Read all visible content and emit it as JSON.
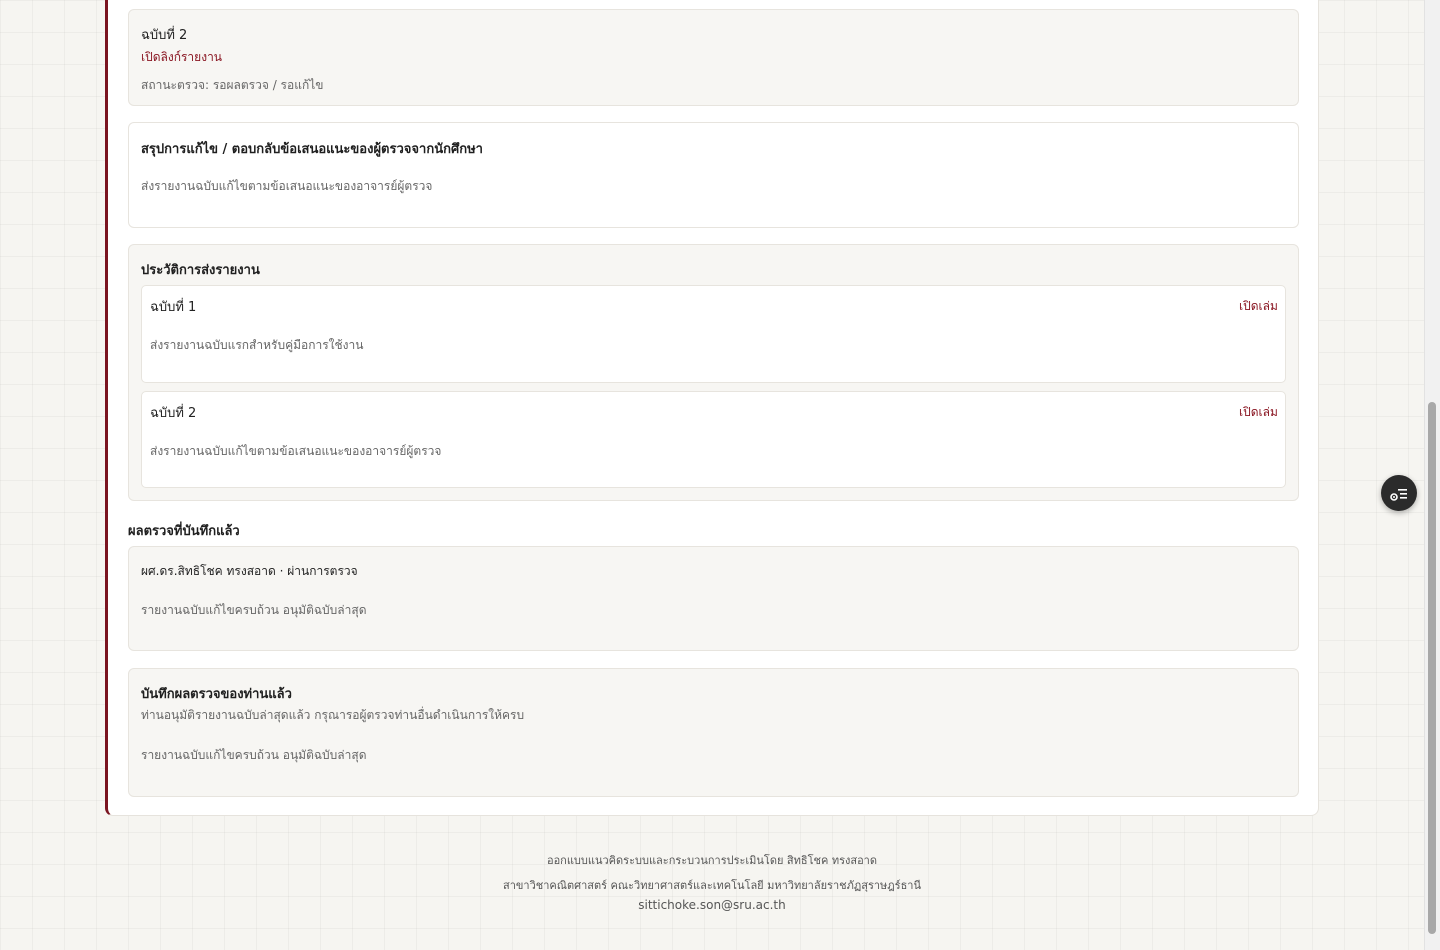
{
  "latest_version": {
    "label": "ฉบับที่ 2",
    "open_link": "เปิดลิงก์รายงาน",
    "status": "สถานะตรวจ: รอผลตรวจ / รอแก้ไข"
  },
  "summary": {
    "heading": "สรุปการแก้ไข / ตอบกลับข้อเสนอแนะของผู้ตรวจจากนักศึกษา",
    "text": "ส่งรายงานฉบับแก้ไขตามข้อเสนอแนะของอาจารย์ผู้ตรวจ"
  },
  "history": {
    "heading": "ประวัติการส่งรายงาน",
    "items": [
      {
        "label": "ฉบับที่ 1",
        "open": "เปิดเล่ม",
        "text": "ส่งรายงานฉบับแรกสำหรับคู่มือการใช้งาน"
      },
      {
        "label": "ฉบับที่ 2",
        "open": "เปิดเล่ม",
        "text": "ส่งรายงานฉบับแก้ไขตามข้อเสนอแนะของอาจารย์ผู้ตรวจ"
      }
    ]
  },
  "saved_results": {
    "heading": "ผลตรวจที่บันทึกแล้ว",
    "reviewer": "ผศ.ดร.สิทธิโชค ทรงสอาด · ผ่านการตรวจ",
    "comment": "รายงานฉบับแก้ไขครบถ้วน อนุมัติฉบับล่าสุด"
  },
  "my_review": {
    "heading": "บันทึกผลตรวจของท่านแล้ว",
    "note": "ท่านอนุมัติรายงานฉบับล่าสุดแล้ว กรุณารอผู้ตรวจท่านอื่นดำเนินการให้ครบ",
    "comment": "รายงานฉบับแก้ไขครบถ้วน อนุมัติฉบับล่าสุด"
  },
  "footer": {
    "line1": "ออกแบบแนวคิดระบบและกระบวนการประเมินโดย สิทธิโชค ทรงสอาด",
    "line2": "สาขาวิชาคณิตศาสตร์ คณะวิทยาศาสตร์และเทคโนโลยี มหาวิทยาลัยราชภัฏสุราษฎร์ธานี",
    "email": "sittichoke.son@sru.ac.th"
  },
  "icons": {
    "fab": "settings-list-icon"
  },
  "colors": {
    "accent": "#8a1622",
    "card_border_accent": "#7a1420"
  }
}
